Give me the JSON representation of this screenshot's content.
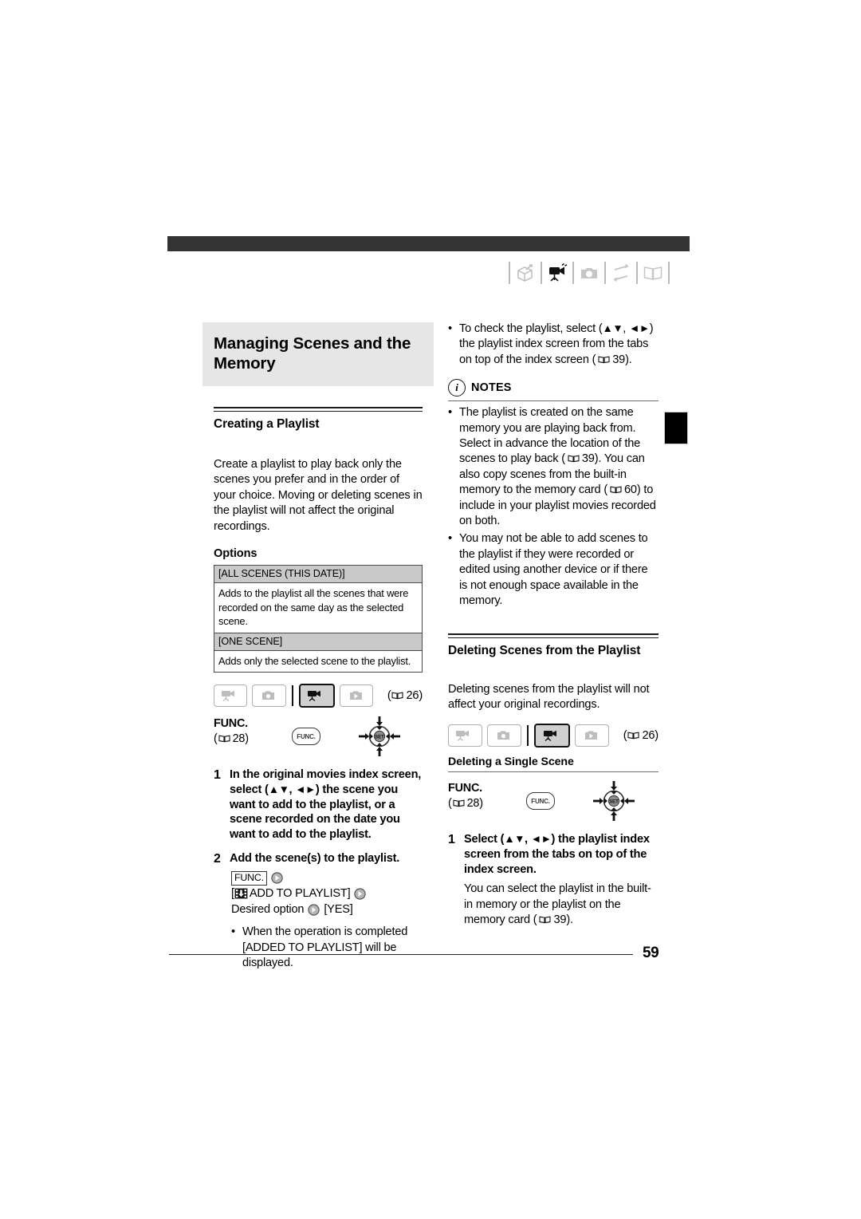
{
  "document": {
    "page_number": "59"
  },
  "header": {
    "chapter_icons": [
      {
        "name": "introduction-box-icon",
        "state": "inactive"
      },
      {
        "name": "camcorder-icon",
        "state": "active"
      },
      {
        "name": "photo-camera-icon",
        "state": "inactive"
      },
      {
        "name": "transfer-arrows-icon",
        "state": "inactive"
      },
      {
        "name": "open-book-icon",
        "state": "inactive"
      }
    ]
  },
  "left_column": {
    "section_title": "Managing Scenes and the Memory",
    "heading": "Creating a Playlist",
    "intro": "Create a playlist to play back only the scenes you prefer and in the order of your choice. Moving or deleting scenes in the playlist will not affect the original recordings.",
    "options_label": "Options",
    "options_table": [
      {
        "option": "[ALL SCENES (THIS DATE)]",
        "description": "Adds to the playlist all the scenes that were recorded on the same day as the selected scene."
      },
      {
        "option": "[ONE SCENE]",
        "description": "Adds only the selected scene to the playlist."
      }
    ],
    "mode_strip": {
      "buttons": [
        {
          "name": "movie-record-mode-icon",
          "active": false
        },
        {
          "name": "photo-record-mode-icon",
          "active": false
        },
        {
          "name": "movie-playback-mode-icon",
          "active": true
        },
        {
          "name": "photo-playback-mode-icon",
          "active": false
        }
      ],
      "page_ref": "26"
    },
    "func_block": {
      "label": "FUNC.",
      "page_ref": "28",
      "button_text": "FUNC.",
      "joystick_label": "SET"
    },
    "steps": [
      {
        "num": "1",
        "text_a": "In the original movies index screen, select (",
        "arrows_a": "▲▼",
        "text_b": ", ",
        "arrows_b": "◄►",
        "text_c": ") the scene you want to add to the playlist, or a scene recorded on the date you want to add to the playlist."
      },
      {
        "num": "2",
        "text_a": "Add the scene(s) to the playlist."
      }
    ],
    "operation_sequence": {
      "func_box": "FUNC.",
      "menu_item": "[",
      "menu_item_text": "ADD TO PLAYLIST]",
      "desired_option": "Desired option",
      "confirm": "[YES]"
    },
    "completion_note": "When the operation is completed [ADDED TO PLAYLIST] will be displayed."
  },
  "right_column": {
    "top_bullet": {
      "text_a": "To check the playlist, select (",
      "arrows_a": "▲▼",
      "text_b": ", ",
      "arrows_b": "◄►",
      "text_c": ") the playlist index screen from the tabs on top of the index screen (",
      "page_ref": "39",
      "text_d": ")."
    },
    "notes": {
      "label": "NOTES",
      "items": [
        {
          "text_a": "The playlist is created on the same memory you are playing back from. Select in advance the location of the scenes to play back (",
          "ref_1": "39",
          "text_b": "). You can also copy scenes from the built-in memory to the memory card (",
          "ref_2": "60",
          "text_c": ") to include in your playlist movies recorded on both."
        },
        {
          "text_a": "You may not be able to add scenes to the playlist if they were recorded or edited using another device or if there is not enough space available in the memory."
        }
      ]
    },
    "heading": "Deleting Scenes from the Playlist",
    "intro": "Deleting scenes from the playlist will not affect your original recordings.",
    "mode_strip": {
      "buttons": [
        {
          "name": "movie-record-mode-icon",
          "active": false
        },
        {
          "name": "photo-record-mode-icon",
          "active": false
        },
        {
          "name": "movie-playback-mode-icon",
          "active": true
        },
        {
          "name": "photo-playback-mode-icon",
          "active": false
        }
      ],
      "page_ref": "26"
    },
    "subheading": "Deleting a Single Scene",
    "func_block": {
      "label": "FUNC.",
      "page_ref": "28",
      "button_text": "FUNC.",
      "joystick_label": "SET"
    },
    "steps": [
      {
        "num": "1",
        "text_a": "Select (",
        "arrows_a": "▲▼",
        "text_b": ", ",
        "arrows_b": "◄►",
        "text_c": ") the playlist index screen from the tabs on top of the index screen.",
        "sub_a": "You can select the playlist in the built-in memory or the playlist on the memory card (",
        "sub_ref": "39",
        "sub_b": ")."
      }
    ]
  }
}
